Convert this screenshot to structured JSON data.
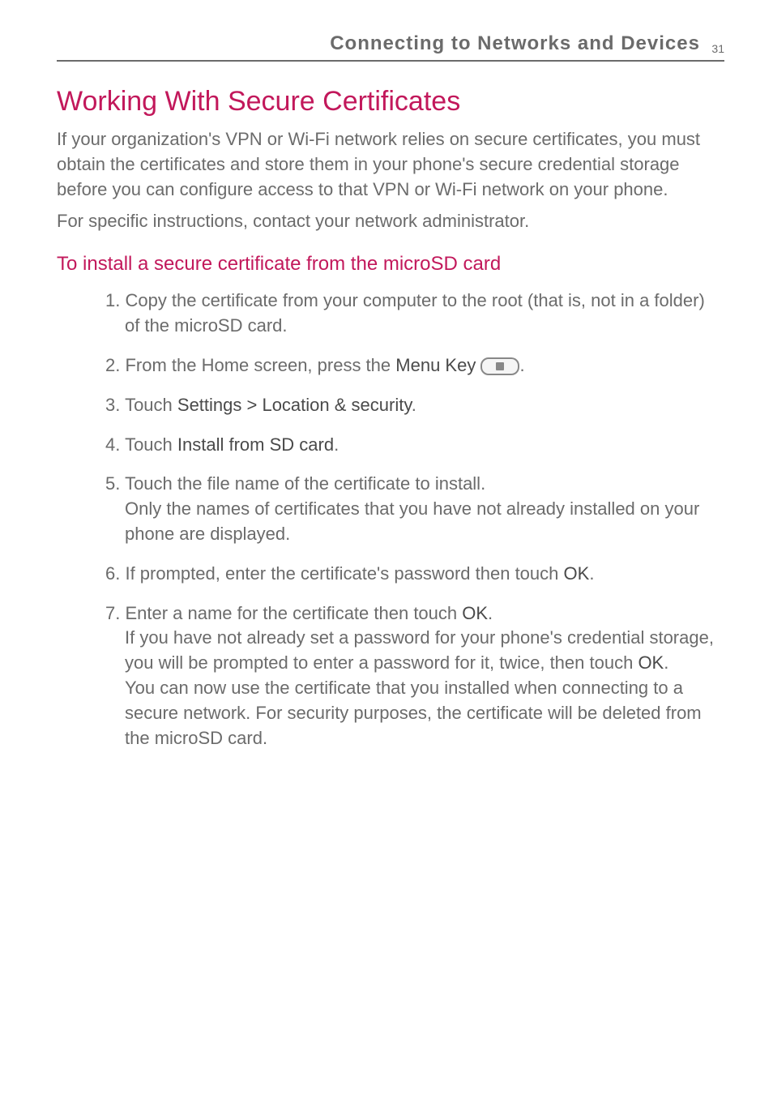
{
  "header": {
    "section_title": "Connecting to Networks and Devices",
    "page_number": "31"
  },
  "main": {
    "heading": "Working With Secure Certificates",
    "intro_p1": "If your organization's VPN or Wi-Fi network relies on secure certificates, you must obtain the certificates and store them in your phone's secure credential storage before you can configure access to that VPN or Wi-Fi network on your phone.",
    "intro_p2": "For specific instructions, contact your network administrator."
  },
  "section": {
    "sub_heading": "To install a secure certificate from the microSD card",
    "steps": {
      "s1": "1. Copy the certificate from your computer to the root (that is, not in a folder) of the microSD card.",
      "s2_prefix": "2. From the Home screen, press the ",
      "s2_bold": "Menu Key ",
      "s2_icon_name": "menu-key-icon",
      "s2_suffix": ".",
      "s3_prefix": "3. Touch ",
      "s3_bold": "Settings > Location & security",
      "s3_suffix": ".",
      "s4_prefix": "4. Touch ",
      "s4_bold": "Install from SD card",
      "s4_suffix": ".",
      "s5_line1": "5. Touch the file name of the certificate to install.",
      "s5_line2": "Only the names of certificates that you have not already installed on your phone are displayed.",
      "s6_prefix": "6. If prompted, enter the certificate's password then touch ",
      "s6_bold": "OK",
      "s6_suffix": ".",
      "s7_prefix": "7. Enter a name for the certificate then touch ",
      "s7_bold1": "OK",
      "s7_mid1": ".",
      "s7_line2a": "If you have not already set a password for your phone's credential storage, you will be prompted to enter a password for it, twice, then touch ",
      "s7_bold2": "OK",
      "s7_mid2": ".",
      "s7_line3": "You can now use the certificate that you installed when connecting to a secure network. For security purposes, the certificate will be deleted from the microSD card."
    }
  }
}
